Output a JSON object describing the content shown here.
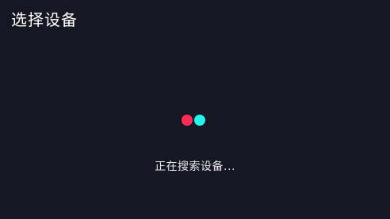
{
  "header": {
    "title": "选择设备"
  },
  "loader": {
    "icon": "loading-dots-icon",
    "colors": {
      "left_dot": "#fe2c55",
      "right_dot": "#25f4ee"
    }
  },
  "status": {
    "text": "正在搜索设备..."
  },
  "colors": {
    "background": "#161722",
    "text": "#ffffff"
  }
}
